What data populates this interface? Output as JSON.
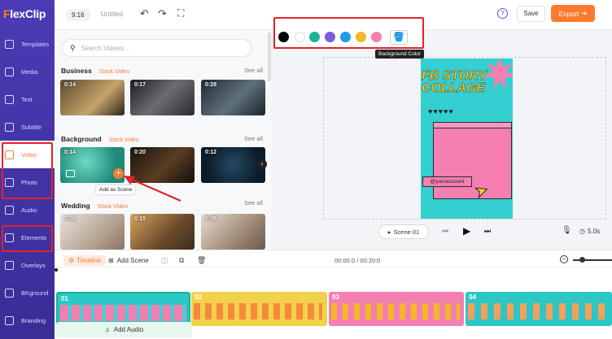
{
  "app": {
    "logo_flex": "F",
    "logo_rest": "lexClip"
  },
  "sidebar": {
    "items": [
      {
        "label": "Templates"
      },
      {
        "label": "Media"
      },
      {
        "label": "Text"
      },
      {
        "label": "Subtitle"
      },
      {
        "label": "Video",
        "active": true
      },
      {
        "label": "Photo"
      },
      {
        "label": "Audio"
      },
      {
        "label": "Elements"
      },
      {
        "label": "Overlays"
      },
      {
        "label": "BKground"
      },
      {
        "label": "Branding"
      }
    ]
  },
  "topbar": {
    "ratio": "9:16",
    "title": "Untitled",
    "save_label": "Save",
    "export_label": "Export"
  },
  "color_picker": {
    "colors": [
      "#000000",
      "#ffffff",
      "#1ab394",
      "#7b5cd9",
      "#1f9bea",
      "#f2b825",
      "#f47fb0"
    ],
    "tooltip": "Background Color"
  },
  "media_panel": {
    "search_placeholder": "Search Videos...",
    "sections": [
      {
        "title": "Business",
        "tag": "Stock Video",
        "see_all": "See all",
        "durations": [
          "0:14",
          "0:17",
          "0:28"
        ]
      },
      {
        "title": "Background",
        "tag": "Stock Video",
        "see_all": "See all",
        "durations": [
          "0:14",
          "0:20",
          "0:12"
        ]
      },
      {
        "title": "Wedding",
        "tag": "Stock Video",
        "see_all": "See all",
        "durations": [
          "0:06",
          "0:15",
          "0:08"
        ]
      }
    ],
    "add_as_scene": "Add as Scene"
  },
  "story": {
    "title_line1": "FB STORY",
    "title_line2": "COLLAGE",
    "hearts": "♥♥♥♥♥",
    "account": "@youraccount"
  },
  "player": {
    "scene_label": "Scene 01",
    "duration": "5.0s"
  },
  "timeline": {
    "timeline_label": "Timeline",
    "add_scene_label": "Add Scene",
    "time": "00:00.0 / 00:20:0",
    "clips": [
      "01",
      "02",
      "03",
      "04"
    ],
    "add_audio_label": "Add Audio"
  }
}
